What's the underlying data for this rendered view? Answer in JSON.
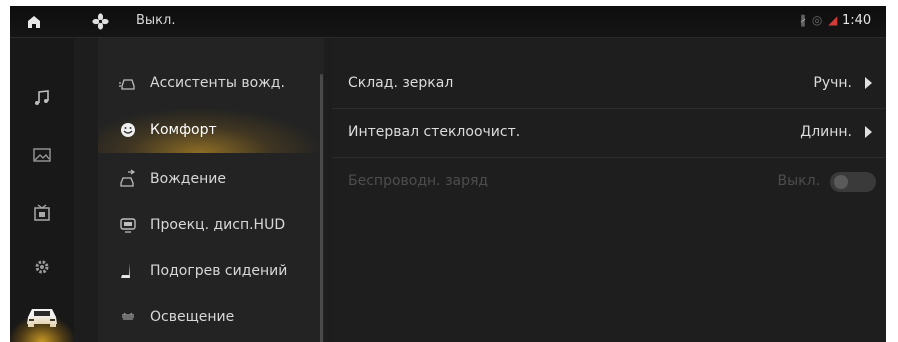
{
  "status_bar": {
    "fan_label": "Выкл.",
    "time": "1:40",
    "indicators": [
      "bluetooth-icon",
      "sim-icon",
      "signal-icon"
    ]
  },
  "rail": {
    "items": [
      "music-icon",
      "gallery-icon",
      "media-icon",
      "settings-icon",
      "car-icon"
    ],
    "active": "car-icon"
  },
  "categories": {
    "items": [
      {
        "label": "Ассистенты вожд.",
        "icon": "assist-icon"
      },
      {
        "label": "Комфорт",
        "icon": "comfort-icon"
      },
      {
        "label": "Вождение",
        "icon": "driving-icon"
      },
      {
        "label": "Проекц. дисп.HUD",
        "icon": "hud-icon"
      },
      {
        "label": "Подогрев сидений",
        "icon": "seat-heat-icon"
      },
      {
        "label": "Освещение",
        "icon": "lighting-icon"
      }
    ],
    "active_index": 1
  },
  "settings": {
    "rows": [
      {
        "label": "Склад. зеркал",
        "value": "Ручн."
      },
      {
        "label": "Интервал стеклоочист.",
        "value": "Длинн."
      },
      {
        "label": "Беспроводн. заряд",
        "value": "Выкл."
      }
    ]
  },
  "colors": {
    "accent": "#e6a826",
    "background": "#1d1d1d",
    "text": "#dcdcdc",
    "disabled_text": "#4d4d4d"
  }
}
